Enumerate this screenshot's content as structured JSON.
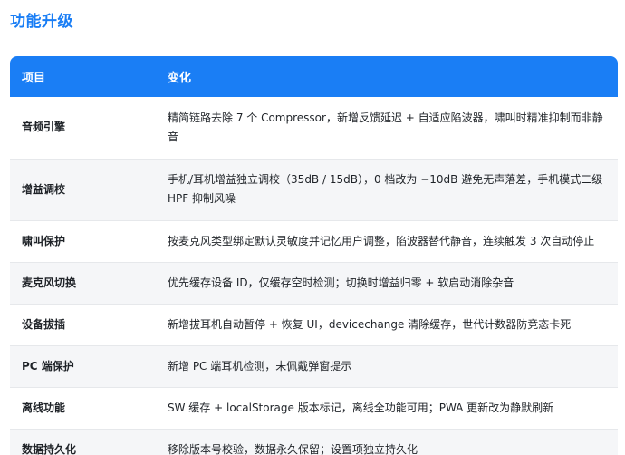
{
  "section": {
    "title": "功能升级"
  },
  "table": {
    "headers": [
      "项目",
      "变化"
    ],
    "rows": [
      {
        "item": "音频引擎",
        "change": "精简链路去除 7 个 Compressor，新增反馈延迟 + 自适应陷波器，啸叫时精准抑制而非静音"
      },
      {
        "item": "增益调校",
        "change": "手机/耳机增益独立调校（35dB / 15dB），0 档改为 −10dB 避免无声落差，手机模式二级 HPF 抑制风噪"
      },
      {
        "item": "啸叫保护",
        "change": "按麦克风类型绑定默认灵敏度并记忆用户调整，陷波器替代静音，连续触发 3 次自动停止"
      },
      {
        "item": "麦克风切换",
        "change": "优先缓存设备 ID，仅缓存空时检测；切换时增益归零 + 软启动消除杂音"
      },
      {
        "item": "设备拔插",
        "change": "新增拔耳机自动暂停 + 恢复 UI，devicechange 清除缓存，世代计数器防竞态卡死"
      },
      {
        "item": "PC 端保护",
        "change": "新增 PC 端耳机检测，未佩戴弹窗提示"
      },
      {
        "item": "离线功能",
        "change": "SW 缓存 + localStorage 版本标记，离线全功能可用；PWA 更新改为静默刷新"
      },
      {
        "item": "数据持久化",
        "change": "移除版本号校验，数据永久保留；设置项独立持久化"
      }
    ]
  },
  "colors": {
    "accent": "#1a7ef5",
    "row_alt": "#f5f6f8",
    "border": "#e6e8eb"
  }
}
